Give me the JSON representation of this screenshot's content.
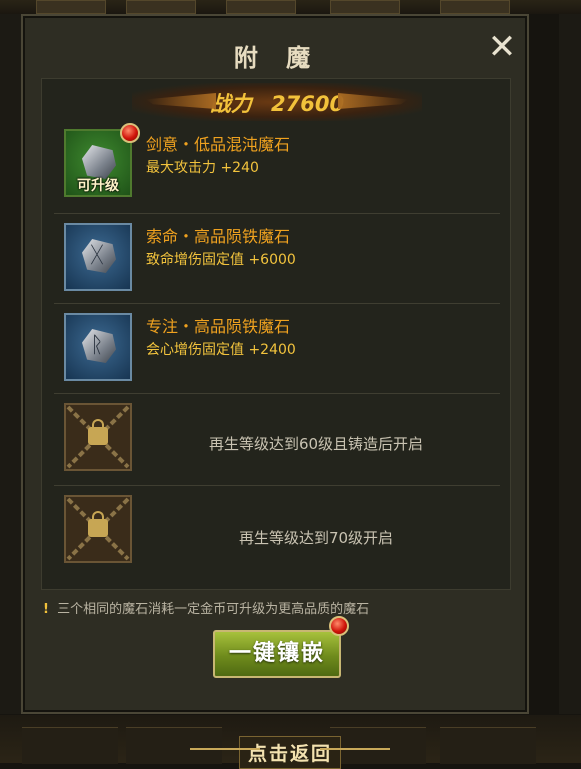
{
  "dialog": {
    "title": "附 魔",
    "close_icon": "close-icon"
  },
  "power": {
    "label": "战力",
    "value": "27600"
  },
  "slots": [
    {
      "name": "剑意・低品混沌魔石",
      "stat": "最大攻击力  +240",
      "upgrade_label": "可升级",
      "state": "upgradable",
      "color": "#2f7a24"
    },
    {
      "name": "索命・高品陨铁魔石",
      "stat": "致命增伤固定值  +6000",
      "state": "filled",
      "color": "#24507a"
    },
    {
      "name": "专注・高品陨铁魔石",
      "stat": "会心增伤固定值  +2400",
      "state": "filled",
      "color": "#24507a"
    },
    {
      "lock_text": "再生等级达到60级且铸造后开启",
      "state": "locked"
    },
    {
      "lock_text": "再生等级达到70级开启",
      "state": "locked"
    }
  ],
  "hint": {
    "text": "三个相同的魔石消耗一定金币可升级为更高品质的魔石"
  },
  "action": {
    "label": "一键镶嵌"
  },
  "footer": {
    "back_label": "点击返回"
  },
  "colors": {
    "item_name": "#f0a21f",
    "stat": "#f2c33d",
    "power": "#f2c23b",
    "button": "#8ea82b"
  }
}
